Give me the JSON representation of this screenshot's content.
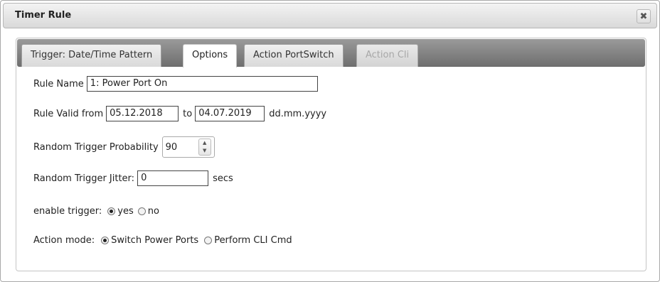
{
  "dialog": {
    "title": "Timer Rule",
    "close_glyph": "✖"
  },
  "tabs": [
    {
      "label": "Trigger: Date/Time Pattern",
      "state": "inactive"
    },
    {
      "label": "Options",
      "state": "active"
    },
    {
      "label": "Action PortSwitch",
      "state": "inactive"
    },
    {
      "label": "Action Cli",
      "state": "disabled"
    }
  ],
  "form": {
    "rule_name": {
      "label": "Rule Name",
      "value": "1: Power Port On"
    },
    "valid": {
      "label": "Rule Valid from",
      "from": "05.12.2018",
      "to_label": "to",
      "to": "04.07.2019",
      "format_hint": "dd.mm.yyyy"
    },
    "probability": {
      "label": "Random Trigger Probability",
      "value": "90"
    },
    "jitter": {
      "label": "Random Trigger Jitter:",
      "value": "0",
      "unit": "secs"
    },
    "enable_trigger": {
      "label": "enable trigger:",
      "options": [
        {
          "label": "yes",
          "checked": true
        },
        {
          "label": "no",
          "checked": false
        }
      ]
    },
    "action_mode": {
      "label": "Action mode:",
      "options": [
        {
          "label": "Switch Power Ports",
          "checked": true
        },
        {
          "label": "Perform CLI Cmd",
          "checked": false
        }
      ]
    }
  }
}
